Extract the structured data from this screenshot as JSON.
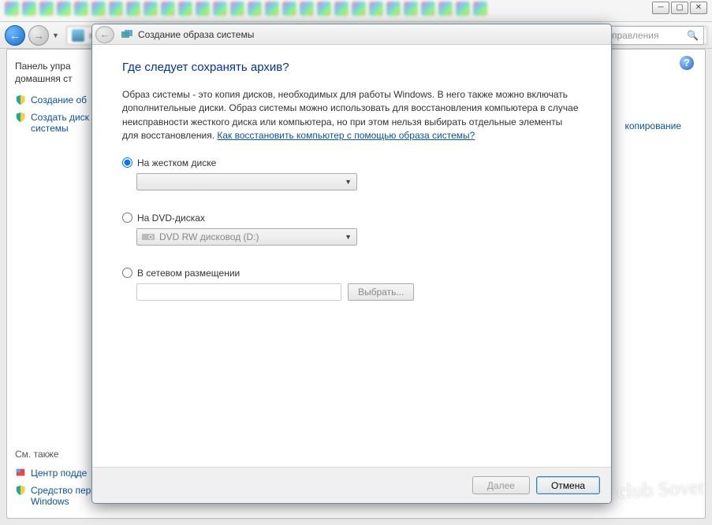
{
  "explorer": {
    "breadcrumb_hint": "... управления",
    "search_placeholder": "управления"
  },
  "bg_panel": {
    "home_line1": "Панель упра",
    "home_line2": "домашняя ст",
    "link_create_image": "Создание об",
    "link_create_disk": "Создать диск",
    "link_create_disk_2": "системы",
    "see_also": "См. также",
    "support_center": "Центр подде",
    "win_tool": "Средство пер",
    "win_tool_2": "Windows",
    "right_link": "копирование"
  },
  "dialog": {
    "title": "Создание образа системы",
    "close_glyph": "✕",
    "heading": "Где следует сохранять архив?",
    "description": "Образ системы - это копия дисков, необходимых для работы Windows. В него также можно включать дополнительные диски. Образ системы можно использовать для восстановления компьютера в случае неисправности жесткого диска или компьютера, но при этом нельзя выбирать отдельные элементы для восстановления.",
    "desc_link": "Как восстановить компьютер с помощью образа системы?",
    "options": {
      "hdd": {
        "label": "На жестком диске",
        "value": ""
      },
      "dvd": {
        "label": "На DVD-дисках",
        "value": "DVD RW дисковод (D:)"
      },
      "net": {
        "label": "В сетевом размещении",
        "browse": "Выбрать..."
      }
    },
    "footer": {
      "next": "Далее",
      "cancel": "Отмена"
    }
  },
  "watermark": "club Sovet"
}
